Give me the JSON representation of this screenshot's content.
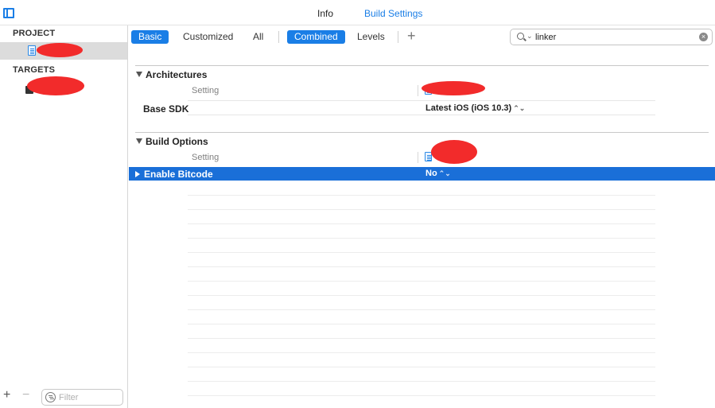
{
  "tabs": {
    "info": "Info",
    "build_settings": "Build Settings"
  },
  "sidebar": {
    "project_heading": "PROJECT",
    "targets_heading": "TARGETS",
    "filter_placeholder": "Filter"
  },
  "toolbar": {
    "basic": "Basic",
    "customized": "Customized",
    "all": "All",
    "combined": "Combined",
    "levels": "Levels",
    "add_symbol": "+",
    "search_value": "linker"
  },
  "groups": [
    {
      "title": "Architectures",
      "column_header": "Setting",
      "rows": [
        {
          "name": "Base SDK",
          "value": "Latest iOS (iOS 10.3)",
          "stepper": "⌃⌄"
        }
      ]
    },
    {
      "title": "Build Options",
      "column_header": "Setting",
      "rows": [
        {
          "name": "Enable Bitcode",
          "value": "No",
          "stepper": "⌃⌄",
          "selected": true
        }
      ]
    }
  ],
  "colors": {
    "accent": "#1a7ee6",
    "selection": "#1a6fd8",
    "redaction": "#f22b2b"
  }
}
